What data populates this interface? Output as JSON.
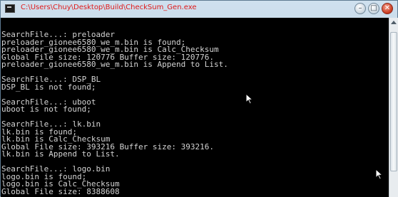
{
  "window": {
    "title": "C:\\Users\\Chuy\\Desktop\\Build\\CheckSum_Gen.exe",
    "caption": {
      "minimize": "–",
      "maximize": "□",
      "close": "✕"
    }
  },
  "console": {
    "lines": [
      "SearchFile...: preloader",
      "preloader_gionee6580_we_m.bin is found;",
      "preloader_gionee6580_we_m.bin is Calc_Checksum",
      "Global File size: 120776 Buffer size: 120776.",
      "preloader_gionee6580_we_m.bin is Append to List.",
      "",
      "SearchFile...: DSP_BL",
      "DSP_BL is not found;",
      "",
      "SearchFile...: uboot",
      "uboot is not found;",
      "",
      "SearchFile...: lk.bin",
      "lk.bin is found;",
      "lk.bin is Calc_Checksum",
      "Global File size: 393216 Buffer size: 393216.",
      "lk.bin is Append to List.",
      "",
      "SearchFile...: logo.bin",
      "logo.bin is found;",
      "logo.bin is Calc_Checksum",
      "Global File size: 8388608"
    ]
  },
  "icons": {
    "app": "console-app-icon",
    "cursor": "mouse-pointer-icon"
  },
  "colors": {
    "title_text": "#e01a1a",
    "console_bg": "#000000",
    "console_fg": "#d4d4d4"
  }
}
